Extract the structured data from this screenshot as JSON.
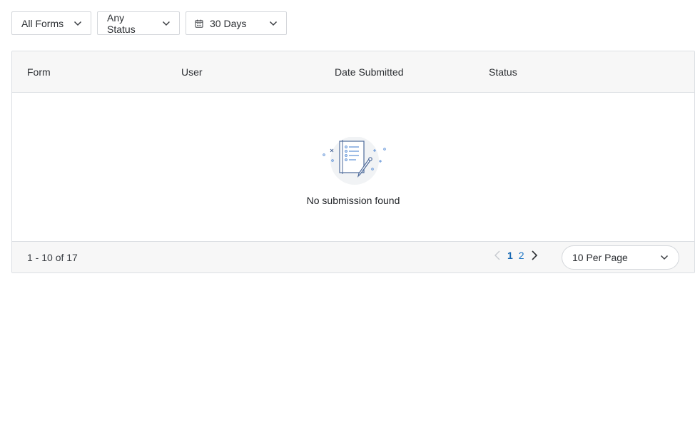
{
  "filters": {
    "forms_label": "All Forms",
    "status_label": "Any Status",
    "date_label": "30 Days"
  },
  "table": {
    "columns": [
      "Form",
      "User",
      "Date Submitted",
      "Status"
    ],
    "empty_message": "No submission found"
  },
  "footer": {
    "range_text": "1 - 10 of 17",
    "pages": [
      "1",
      "2"
    ],
    "current_page": "1",
    "per_page_label": "10 Per Page"
  },
  "colors": {
    "accent": "#1a73c4",
    "border": "#dcdfe3",
    "header_bg": "#f7f7f7"
  },
  "icons": [
    "chevron-down-icon",
    "calendar-icon",
    "chevron-left-icon",
    "chevron-right-icon",
    "empty-form-illustration"
  ]
}
